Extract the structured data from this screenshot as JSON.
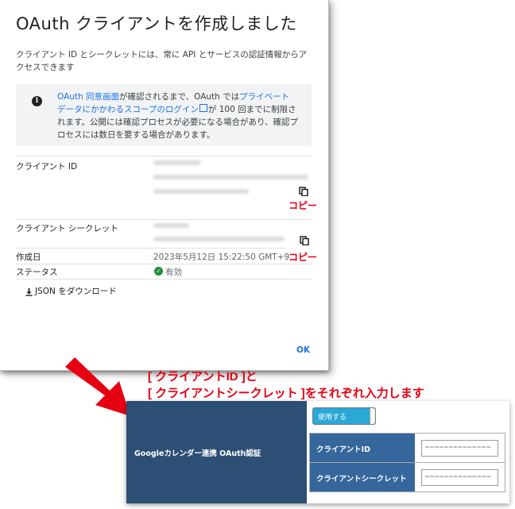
{
  "dialog": {
    "title": "OAuth クライアントを作成しました",
    "description": "クライアント ID とシークレットには、常に API とサービスの認証情報からアクセスできます",
    "info": {
      "link1": "OAuth 同意画面",
      "text1": "が確認されるまで、OAuth では",
      "link2": "プライベート データにかかわるスコープのログイン",
      "text2": "が 100 回までに制限されます。公開には確認プロセスが必要になる場合があり、確認プロセスには数日を要する場合があります。"
    },
    "client_id_label": "クライアント ID",
    "client_secret_label": "クライアント シークレット",
    "created_label": "作成日",
    "created_value": "2023年5月12日 15:22:50 GMT+9",
    "status_label": "ステータス",
    "status_value": "有効",
    "download_label": "JSON をダウンロード",
    "ok_label": "OK"
  },
  "annotations": {
    "copy_note": "コピー",
    "instruction_line1": "[ クライアントID ]と",
    "instruction_line2": "[ クライアントシークレット ]をそれぞれ入力します"
  },
  "settings_panel": {
    "section_label": "Googleカレンダー連携 OAuth認証",
    "toggle_label": "使用する",
    "client_id_label": "クライアントID",
    "client_id_value": "~~~~~~~~~~~~~~",
    "client_secret_label": "クライアントシークレット",
    "client_secret_value": "~~~~~~~~~~~~~~"
  },
  "colors": {
    "accent": "#1a73e8",
    "annotation": "#e60012",
    "panel_dark": "#2d4f75",
    "panel_label": "#35679c",
    "toggle": "#2aa8d8",
    "status_ok": "#1e8e3e"
  },
  "icons": [
    "info-icon",
    "external-link-icon",
    "copy-icon",
    "check-circle-icon",
    "download-icon",
    "arrow-icon"
  ]
}
